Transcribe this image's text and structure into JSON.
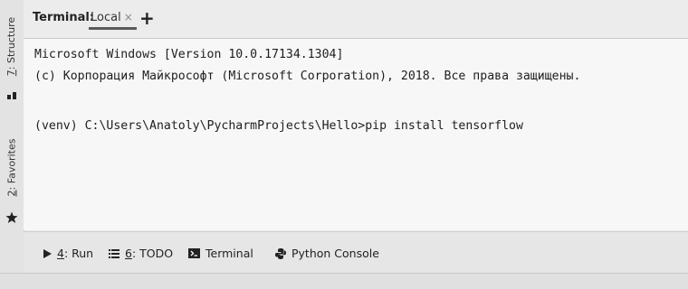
{
  "left_strip": {
    "structure_num": "7",
    "structure_label": ": Structure",
    "favorites_num": "2",
    "favorites_label": ": Favorites"
  },
  "tabs": {
    "title": "Terminal:",
    "local": "Local",
    "close": "×",
    "add": "+"
  },
  "terminal": {
    "lines": [
      "Microsoft Windows [Version 10.0.17134.1304]",
      "(c) Корпорация Майкрософт (Microsoft Corporation), 2018. Все права защищены.",
      "(venv) C:\\Users\\Anatoly\\PycharmProjects\\Hello>pip install tensorflow"
    ]
  },
  "bottom_tools": {
    "run_num": "4",
    "run_label": ": Run",
    "todo_num": "6",
    "todo_label": ": TODO",
    "terminal": "Terminal",
    "python_console": "Python Console"
  },
  "icons": {
    "structure": "structure-icon",
    "favorites": "star-icon",
    "run": "play-icon",
    "todo": "list-icon",
    "terminal": "terminal-icon",
    "python": "python-icon",
    "layout": "square-icon"
  }
}
